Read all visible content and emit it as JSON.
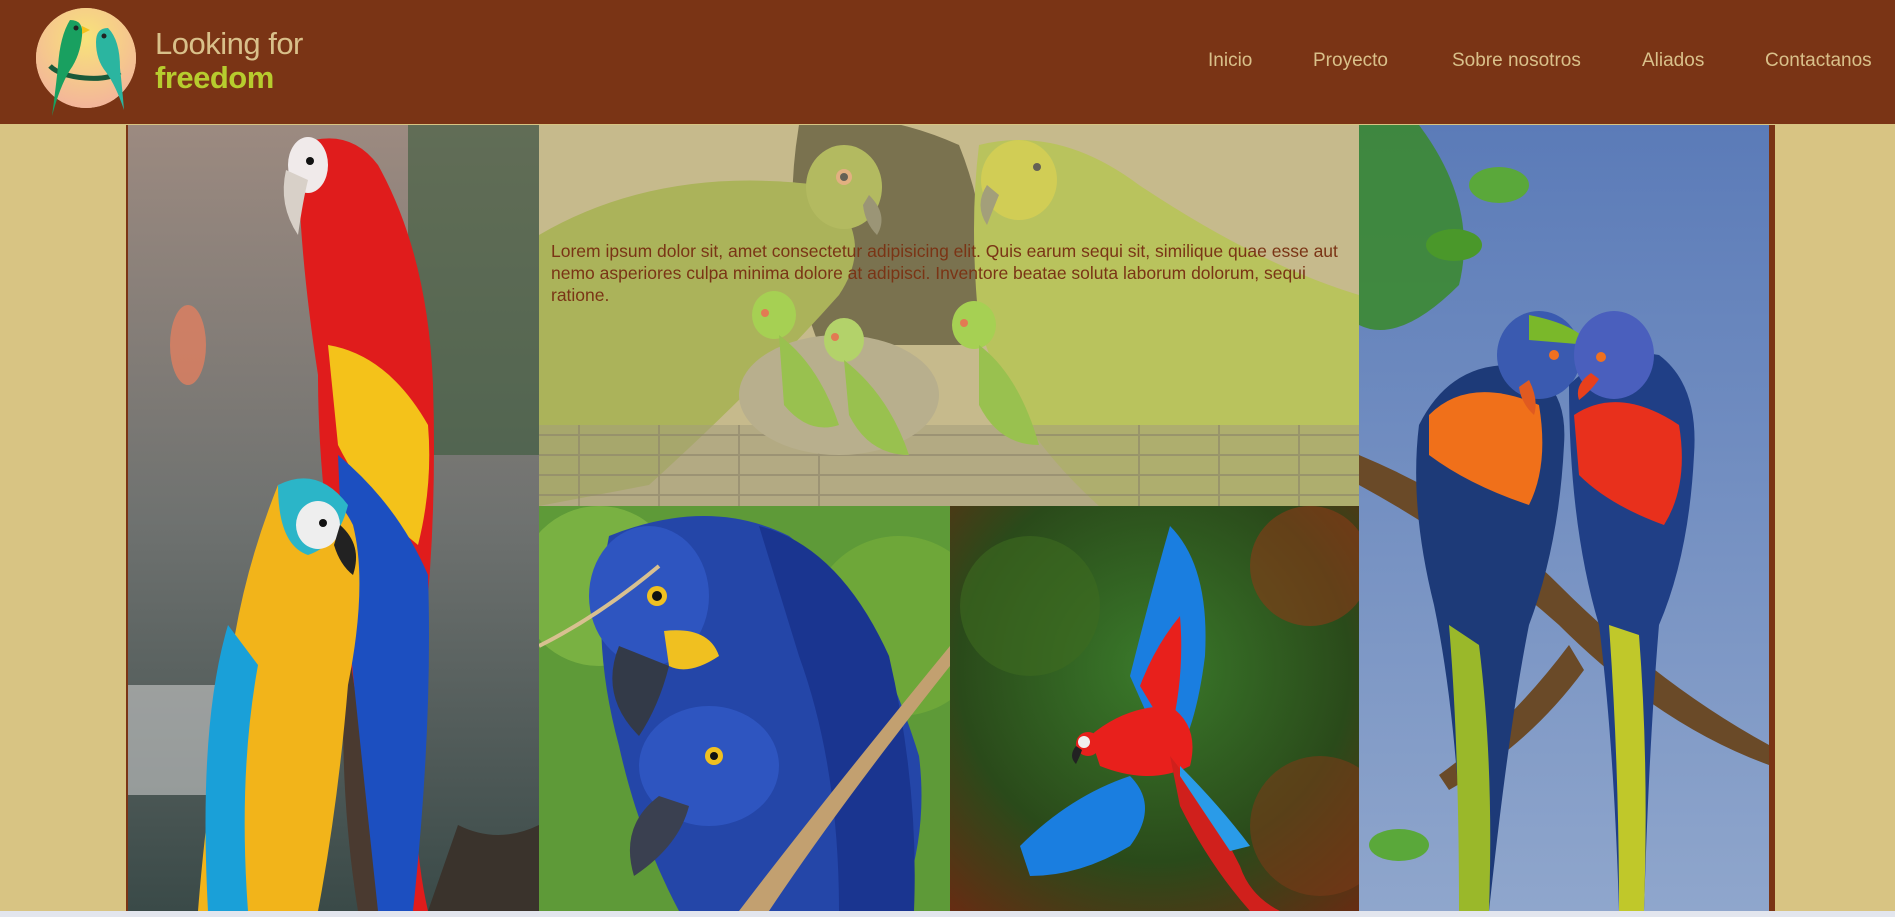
{
  "brand": {
    "line1": "Looking for",
    "line2": "freedom",
    "logo_icon": "parrots-logo-icon"
  },
  "nav": {
    "items": [
      {
        "label": "Inicio"
      },
      {
        "label": "Proyecto"
      },
      {
        "label": "Sobre nosotros"
      },
      {
        "label": "Aliados"
      },
      {
        "label": "Contactanos"
      }
    ]
  },
  "gallery": {
    "featured_text": "Lorem ipsum dolor sit, amet consectetur adipisicing elit. Quis earum sequi sit, similique quae esse aut nemo asperiores culpa minima dolore at adipisci. Inventore beatae soluta laborum dolorum, sequi ratione."
  },
  "colors": {
    "header_bg": "#7a3415",
    "page_bg": "#d8c483",
    "nav_text": "#d9c08a",
    "accent_green": "#b7cc2e"
  }
}
